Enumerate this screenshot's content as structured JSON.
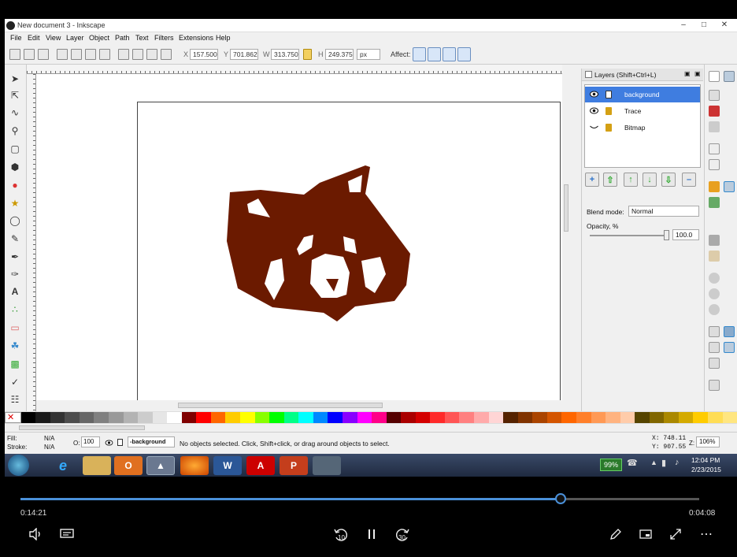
{
  "window": {
    "title": "New document 3 - Inkscape"
  },
  "menu": [
    "File",
    "Edit",
    "View",
    "Layer",
    "Object",
    "Path",
    "Text",
    "Filters",
    "Extensions",
    "Help"
  ],
  "toolbar": {
    "x_label": "X",
    "x_value": "157.500",
    "y_label": "Y",
    "y_value": "701.862",
    "w_label": "W",
    "w_value": "313.750",
    "h_label": "H",
    "h_value": "249.375",
    "unit": "px",
    "affect_label": "Affect:"
  },
  "layers_panel": {
    "title": "Layers (Shift+Ctrl+L)",
    "layers": [
      {
        "name": "background",
        "selected": true
      },
      {
        "name": "Trace",
        "selected": false
      },
      {
        "name": "Bitmap",
        "selected": false
      }
    ],
    "blend_label": "Blend mode:",
    "blend_value": "Normal",
    "opacity_label": "Opacity, %",
    "opacity_value": "100.0"
  },
  "status": {
    "fill_label": "Fill:",
    "fill_value": "N/A",
    "stroke_label": "Stroke:",
    "stroke_value": "N/A",
    "o_label": "O:",
    "o_value": "100",
    "layer_value": "-background",
    "message": "No objects selected. Click, Shift+click, or drag around objects to select.",
    "x_coord": "X: 748.11",
    "y_coord": "Y: 907.55",
    "z_label": "Z:",
    "zoom": "106%"
  },
  "taskbar": {
    "battery": "99%",
    "time": "12:04 PM",
    "date": "2/23/2015"
  },
  "video": {
    "elapsed": "0:14:21",
    "remaining": "0:04:08",
    "progress": 0.796,
    "skip_back": "10",
    "skip_forward": "30"
  },
  "colors": {
    "panda": "#6b1a00",
    "selection": "#3f7de0",
    "seek": "#4a90d9"
  }
}
